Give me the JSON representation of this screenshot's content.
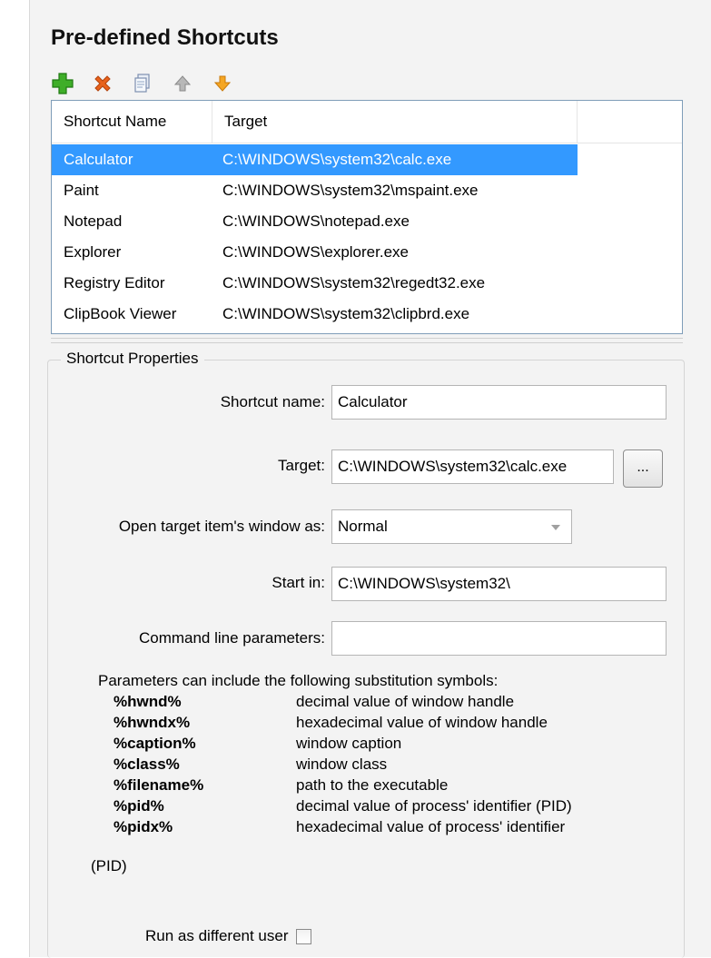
{
  "section_title": "Pre-defined Shortcuts",
  "toolbar": {
    "add": "add-icon",
    "delete": "delete-icon",
    "copy": "copy-icon",
    "move_up": "arrow-up-icon",
    "move_down": "arrow-down-icon"
  },
  "list": {
    "columns": [
      "Shortcut Name",
      "Target"
    ],
    "rows": [
      {
        "name": "Calculator",
        "target": "C:\\WINDOWS\\system32\\calc.exe",
        "selected": true
      },
      {
        "name": "Paint",
        "target": "C:\\WINDOWS\\system32\\mspaint.exe"
      },
      {
        "name": "Notepad",
        "target": "C:\\WINDOWS\\notepad.exe"
      },
      {
        "name": "Explorer",
        "target": "C:\\WINDOWS\\explorer.exe"
      },
      {
        "name": "Registry Editor",
        "target": "C:\\WINDOWS\\system32\\regedt32.exe"
      },
      {
        "name": "ClipBook Viewer",
        "target": "C:\\WINDOWS\\system32\\clipbrd.exe"
      }
    ]
  },
  "props": {
    "group_title": "Shortcut Properties",
    "shortcut_name_label": "Shortcut name:",
    "shortcut_name_value": "Calculator",
    "target_label": "Target:",
    "target_value": "C:\\WINDOWS\\system32\\calc.exe",
    "browse_label": "...",
    "window_label": "Open target item's window as:",
    "window_value": "Normal",
    "start_in_label": "Start in:",
    "start_in_value": "C:\\WINDOWS\\system32\\",
    "cmdline_label": "Command line parameters:",
    "cmdline_value": "",
    "help_intro": "Parameters can include the following substitution symbols:",
    "symbols": [
      {
        "sym": "%hwnd%",
        "desc": "decimal value of window handle"
      },
      {
        "sym": "%hwndx%",
        "desc": "hexadecimal value of window handle"
      },
      {
        "sym": "%caption%",
        "desc": "window caption"
      },
      {
        "sym": "%class%",
        "desc": "window class"
      },
      {
        "sym": "%filename%",
        "desc": "path to the executable"
      },
      {
        "sym": "%pid%",
        "desc": "decimal value of process' identifier (PID)"
      },
      {
        "sym": "%pidx%",
        "desc": "hexadecimal value of process' identifier"
      }
    ],
    "help_tail": "(PID)",
    "run_as_label": "Run as different user",
    "run_as_checked": false
  }
}
